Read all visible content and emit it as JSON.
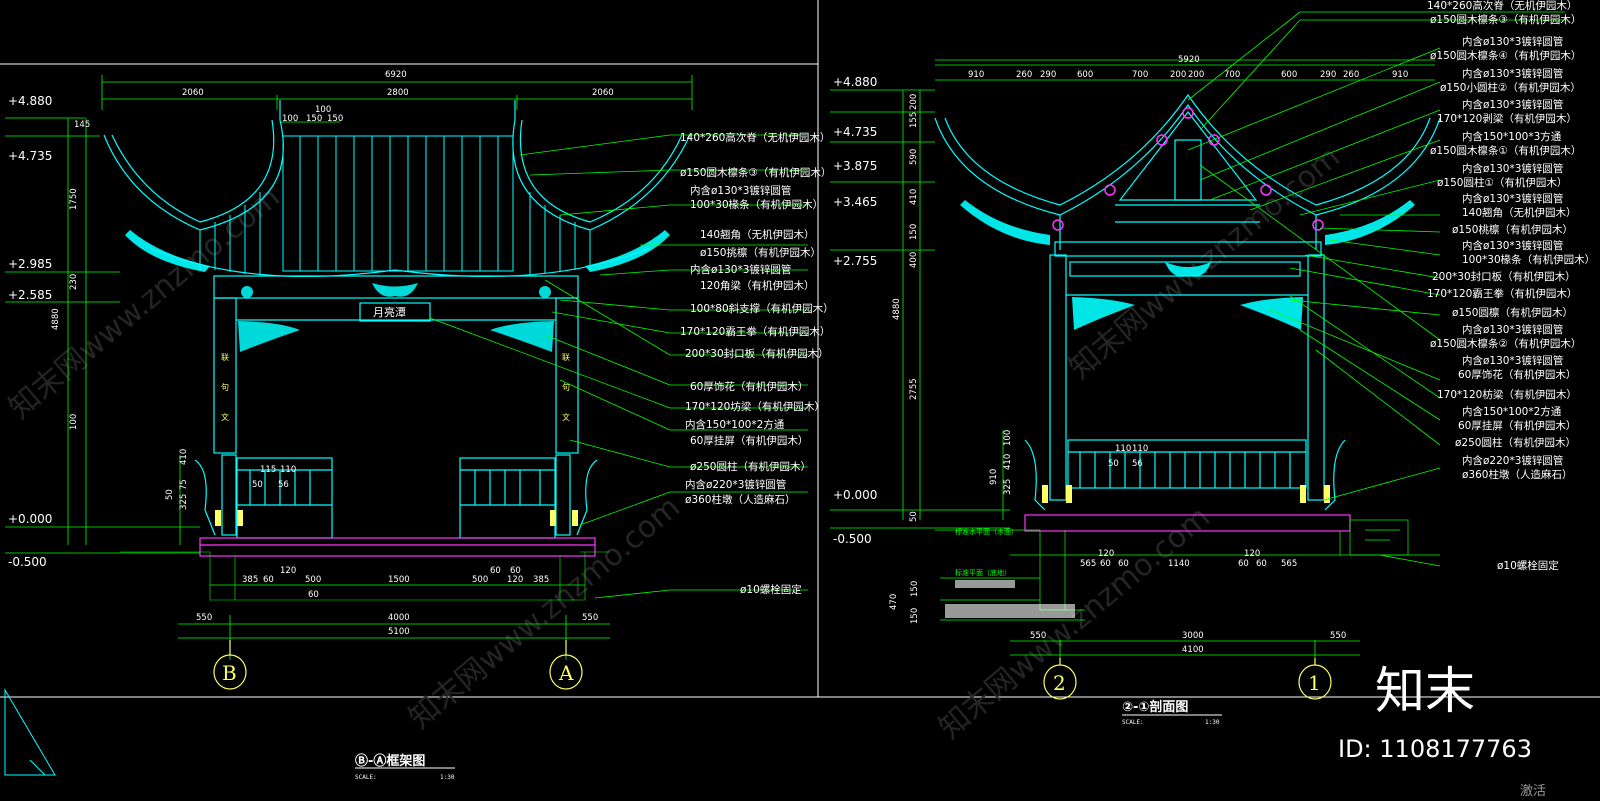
{
  "colors": {
    "bg": "#000000",
    "cyan": "#00ffff",
    "green": "#00ff00",
    "magenta": "#ff33ff",
    "yellow": "#ffff66",
    "white": "#ffffff"
  },
  "left_view": {
    "title": "Ⓑ-Ⓐ框架图",
    "scale_label": "SCALE:",
    "scale": "1:30",
    "sign": "月亮潭",
    "levels": [
      "+4.880",
      "+4.735",
      "+2.985",
      "+2.585",
      "+0.000",
      "-0.500"
    ],
    "top_dims": {
      "overall": "6920",
      "parts": [
        "2060",
        "2800",
        "2060"
      ],
      "small_top": "100",
      "small": [
        "100",
        "150",
        "150"
      ]
    },
    "vertical_dims": [
      "145",
      "1750",
      "400",
      "170",
      "230",
      "2585",
      "4880",
      "100",
      "410",
      "75",
      "325",
      "910",
      "50"
    ],
    "bottom_dims_row1": [
      "385",
      "60",
      "120",
      "500",
      "1500",
      "500",
      "120",
      "385"
    ],
    "bottom_dims_row1b": [
      "60",
      "60"
    ],
    "bottom_dims_row2": [
      "550",
      "4000",
      "550"
    ],
    "bottom_total": "5100",
    "bottom_small": "60",
    "rail_dims": [
      "115",
      "110",
      "50",
      "56"
    ],
    "axes": [
      "B",
      "A"
    ],
    "callouts": [
      "140*260高次脊（无机伊园木）",
      "ø150圆木檩条③（有机伊园木）",
      "内含ø130*3镀锌圆管",
      "100*30椽条（有机伊园木）",
      "140翘角（无机伊园木）",
      "ø150挑檩（有机伊园木）",
      "内含ø130*3镀锌圆管",
      "120角梁（有机伊园木）",
      "100*80斜支撑（有机伊园木）",
      "170*120霸王拳（有机伊园木）",
      "200*30封口板（有机伊园木）",
      "60厚饰花（有机伊园木）",
      "170*120坊梁（有机伊园木）",
      "内含150*100*2方通",
      "60厚挂屏（有机伊园木）",
      "ø250圆柱（有机伊园木）",
      "内含ø220*3镀锌圆管",
      "ø360柱墩（人造麻石）",
      "ø10螺栓固定"
    ]
  },
  "right_view": {
    "title": "②-①剖面图",
    "scale_label": "SCALE:",
    "scale": "1:30",
    "levels": [
      "+4.880",
      "+4.735",
      "+3.875",
      "+3.465",
      "+2.755",
      "+0.000",
      "-0.500"
    ],
    "top_dims": {
      "overall": "5920",
      "parts": [
        "910",
        "260",
        "290",
        "600",
        "700",
        "200",
        "200",
        "700",
        "600",
        "290",
        "260",
        "910"
      ]
    },
    "vertical_dims": [
      "200",
      "155",
      "590",
      "410",
      "150",
      "60",
      "400",
      "4880",
      "2755",
      "100",
      "410",
      "75",
      "325",
      "910",
      "50"
    ],
    "bottom_dims_row1": [
      "565",
      "60",
      "60",
      "1140",
      "60",
      "60",
      "565"
    ],
    "bottom_dims_small": [
      "120",
      "120"
    ],
    "bottom_dims_row2": [
      "550",
      "3000",
      "550"
    ],
    "bottom_total": "4100",
    "rail_dims": [
      "110",
      "110",
      "50",
      "56"
    ],
    "water_labels": [
      "标准水平面（水面）",
      "标准平面（底地）"
    ],
    "left_small_dims": [
      "150",
      "150",
      "470",
      "150"
    ],
    "axes": [
      "2",
      "1"
    ],
    "callouts": [
      "140*260高次脊（无机伊园木）",
      "ø150圆木檩条③（有机伊园木）",
      "内含ø130*3镀锌圆管",
      "ø150圆木檩条④（有机伊园木）",
      "内含ø130*3镀锌圆管",
      "ø150小圆柱②（有机伊园木）",
      "内含ø130*3镀锌圆管",
      "170*120剥梁（有机伊园木）",
      "内含150*100*3方通",
      "ø150圆木檩条①（有机伊园木）",
      "内含ø130*3镀锌圆管",
      "ø150圆柱①（有机伊园木）",
      "内含ø130*3镀锌圆管",
      "140翘角（无机伊园木）",
      "ø150桃檩（有机伊园木）",
      "内含ø130*3镀锌圆管",
      "100*30椽条（有机伊园木）",
      "200*30封口板（有机伊园木）",
      "170*120霸王拳（有机伊园木）",
      "ø150圆檩（有机伊园木）",
      "内含ø130*3镀锌圆管",
      "ø150圆木檩条②（有机伊园木）",
      "内含ø130*3镀锌圆管",
      "60厚饰花（有机伊园木）",
      "170*120枋梁（有机伊园木）",
      "内含150*100*2方通",
      "60厚挂屏（有机伊园木）",
      "ø250圆柱（有机伊园木）",
      "内含ø220*3镀锌圆管",
      "ø360柱墩（人造麻石）",
      "ø10螺栓固定"
    ]
  },
  "branding": {
    "logo": "知末",
    "id_text": "ID: 1108177763",
    "watermark": "知末网www.znzmo.com",
    "corner_text": "激活"
  }
}
